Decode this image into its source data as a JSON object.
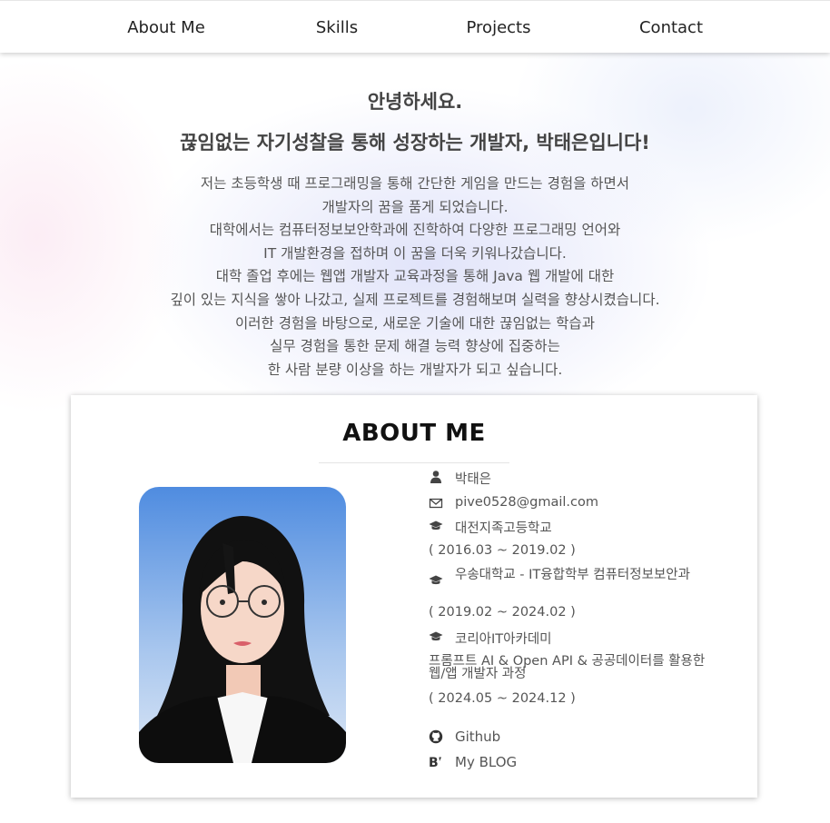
{
  "nav": {
    "items": [
      {
        "label": "About Me"
      },
      {
        "label": "Skills"
      },
      {
        "label": "Projects"
      },
      {
        "label": "Contact"
      }
    ]
  },
  "intro": {
    "greeting": "안녕하세요.",
    "headline": "끊임없는 자기성찰을 통해 성장하는 개발자, 박태은입니다!",
    "lines": [
      "저는 초등학생 때 프로그래밍을 통해 간단한 게임을 만드는 경험을 하면서",
      "개발자의 꿈을 품게 되었습니다.",
      "대학에서는 컴퓨터정보보안학과에 진학하여 다양한 프로그래밍 언어와",
      "IT 개발환경을 접하며 이 꿈을 더욱 키워나갔습니다.",
      "대학 졸업 후에는 웹앱 개발자 교육과정을 통해 Java 웹 개발에 대한",
      "깊이 있는 지식을 쌓아 나갔고, 실제 프로젝트를 경험해보며 실력을 향상시켰습니다.",
      "이러한 경험을 바탕으로, 새로운 기술에 대한 끊임없는 학습과",
      "실무 경험을 통한 문제 해결 능력 향상에 집중하는",
      "한 사람 분량 이상을 하는 개발자가 되고 싶습니다."
    ]
  },
  "about": {
    "title": "ABOUT ME",
    "name": "박태은",
    "email": "pive0528@gmail.com",
    "high_school": "대전지족고등학교",
    "high_school_period": "( 2016.03 ~ 2019.02 )",
    "university": "우송대학교 - IT융합학부 컴퓨터정보보안과",
    "university_period": "( 2019.02 ~ 2024.02 )",
    "academy": "코리아IT아카데미",
    "academy_course": "프롬프트 AI & Open API & 공공데이터를 활용한 웹/앱 개발자 과정",
    "academy_period": "( 2024.05 ~ 2024.12 )",
    "github_label": "Github",
    "blog_label": "My BLOG"
  },
  "icons": {
    "name": "user-icon",
    "email": "envelope-icon",
    "education": "graduation-cap-icon",
    "github": "github-icon",
    "blog": "blog-icon"
  },
  "colors": {
    "text": "#555555",
    "heading": "#444444",
    "title": "#111111",
    "photo_background_top": "#4f8ce0",
    "photo_background_bottom": "#dbe6f5"
  }
}
